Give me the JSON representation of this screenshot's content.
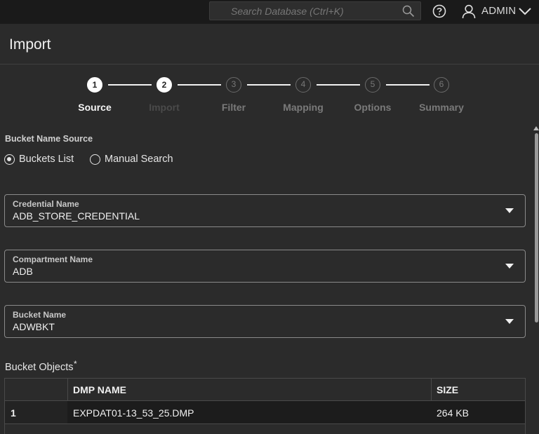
{
  "header": {
    "search_placeholder": "Search Database (Ctrl+K)",
    "user_name": "ADMIN"
  },
  "page": {
    "title": "Import"
  },
  "stepper": {
    "steps": [
      {
        "number": "1",
        "label": "Source",
        "state": "active"
      },
      {
        "number": "2",
        "label": "Import",
        "state": "completed"
      },
      {
        "number": "3",
        "label": "Filter",
        "state": "inactive"
      },
      {
        "number": "4",
        "label": "Mapping",
        "state": "inactive"
      },
      {
        "number": "5",
        "label": "Options",
        "state": "inactive"
      },
      {
        "number": "6",
        "label": "Summary",
        "state": "inactive"
      }
    ]
  },
  "source": {
    "bucket_name_source_label": "Bucket Name Source",
    "options": [
      {
        "label": "Buckets List",
        "selected": true
      },
      {
        "label": "Manual Search",
        "selected": false
      }
    ]
  },
  "fields": {
    "credential": {
      "label": "Credential Name",
      "value": "ADB_STORE_CREDENTIAL"
    },
    "compartment": {
      "label": "Compartment Name",
      "value": "ADB"
    },
    "bucket": {
      "label": "Bucket Name",
      "value": "ADWBKT"
    }
  },
  "bucket_objects": {
    "label": "Bucket Objects",
    "required_mark": "*",
    "columns": {
      "name": "DMP NAME",
      "size": "SIZE"
    },
    "rows": [
      {
        "index": "1",
        "name": "EXPDAT01-13_53_25.DMP",
        "size": "264 KB"
      }
    ]
  },
  "colors": {
    "background": "#2b2b2b",
    "topbar": "#1a1a1a",
    "active_step": "#ffffff",
    "inactive_step": "#6a6a6a"
  }
}
